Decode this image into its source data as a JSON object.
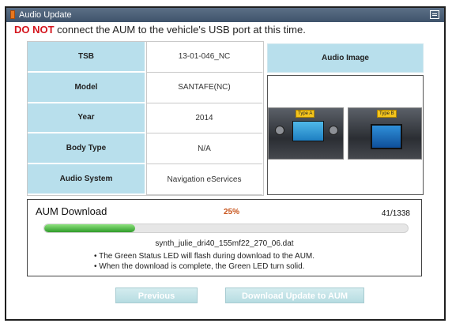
{
  "window": {
    "title": "Audio Update"
  },
  "warning": {
    "strong": "DO NOT",
    "rest": " connect the AUM to the vehicle's USB port at this time."
  },
  "info": {
    "rows": [
      {
        "label": "TSB",
        "value": "13-01-046_NC"
      },
      {
        "label": "Model",
        "value": "SANTAFE(NC)"
      },
      {
        "label": "Year",
        "value": "2014"
      },
      {
        "label": "Body Type",
        "value": "N/A"
      },
      {
        "label": "Audio System",
        "value": "Navigation eServices"
      }
    ]
  },
  "audio": {
    "header": "Audio Image",
    "type_a": "Type A",
    "type_b": "Type B"
  },
  "download": {
    "title": "AUM Download",
    "percent": "25%",
    "progress_fraction": 0.25,
    "count": "41/1338",
    "filename": "synth_julie_dri40_155mf22_270_06.dat",
    "note1": "• The Green Status LED will flash during download to the AUM.",
    "note2": "• When the download is complete, the Green LED turn solid."
  },
  "buttons": {
    "previous": "Previous",
    "download": "Download Update to AUM"
  },
  "colors": {
    "header_blue": "#b8dfec",
    "warning_red": "#d4141d",
    "progress_green": "#2f9b2a",
    "percent_orange": "#c8531a"
  }
}
